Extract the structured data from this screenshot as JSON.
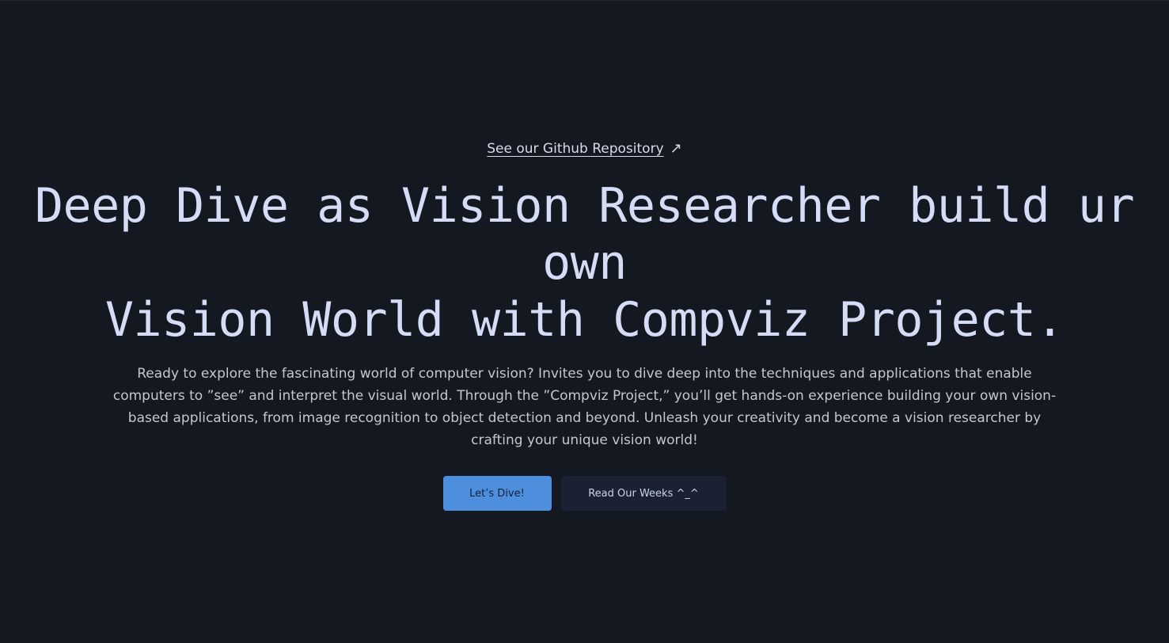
{
  "hero": {
    "repo_link_label": "See our Github Repository",
    "repo_link_icon": "↗",
    "headline_line1": "Deep Dive as Vision Researcher build ur own",
    "headline_line2": "Vision World with Compviz Project.",
    "description": "Ready to explore the fascinating world of computer vision? Invites you to dive deep into the techniques and applications that enable computers to ”see” and interpret the visual world. Through the ”Compviz Project,” you’ll get hands-on experience building your own vision-based applications, from image recognition to object detection and beyond. Unleash your creativity and become a vision researcher by crafting your unique vision world!",
    "primary_button_label": "Let’s Dive!",
    "secondary_button_label": "Read Our Weeks ^_^"
  },
  "colors": {
    "background": "#141820",
    "headline": "#d4dcf6",
    "primary_button": "#4d8fdd",
    "secondary_button": "#1a2133"
  }
}
